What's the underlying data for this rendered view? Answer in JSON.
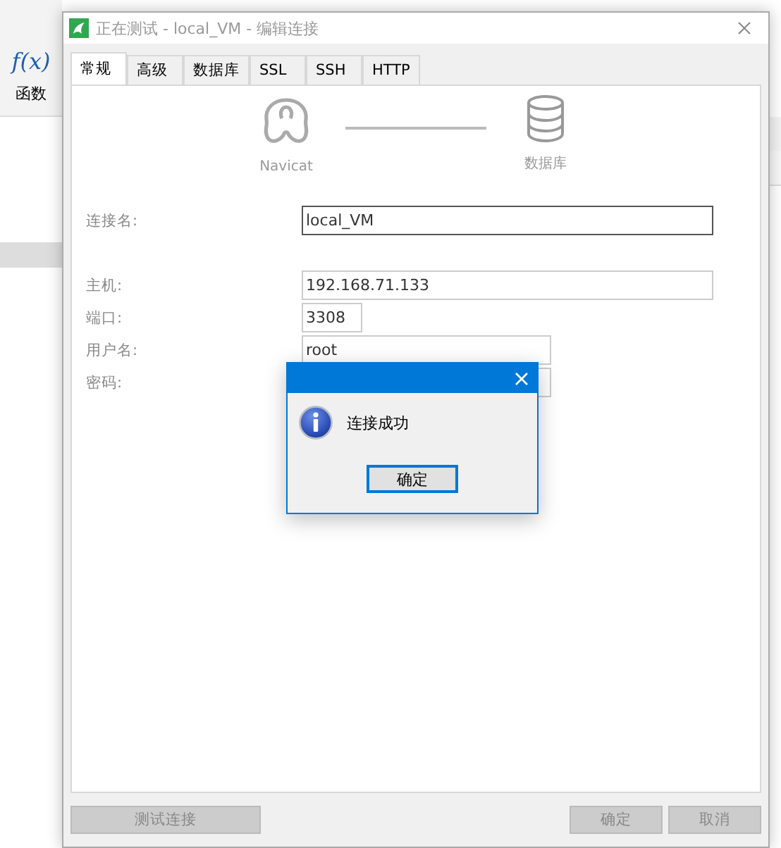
{
  "background_app": {
    "function_icon_text": "f(x)",
    "function_label": "函数"
  },
  "window": {
    "title": "正在测试 - local_VM - 编辑连接"
  },
  "tabs": [
    {
      "label": "常规",
      "selected": true
    },
    {
      "label": "高级",
      "selected": false
    },
    {
      "label": "数据库",
      "selected": false
    },
    {
      "label": "SSL",
      "selected": false
    },
    {
      "label": "SSH",
      "selected": false
    },
    {
      "label": "HTTP",
      "selected": false
    }
  ],
  "diagram": {
    "left_label": "Navicat",
    "right_label": "数据库"
  },
  "fields": [
    {
      "label": "连接名:",
      "value": "local_VM",
      "focused": true
    },
    {
      "label": "主机:",
      "value": "192.168.71.133",
      "focused": false
    },
    {
      "label": "端口:",
      "value": "3308",
      "focused": false
    },
    {
      "label": "用户名:",
      "value": "root",
      "focused": false
    },
    {
      "label": "密码:",
      "focused": false
    }
  ],
  "buttons": [
    {
      "label": "测试连接",
      "disabled": true
    },
    {
      "label": "确定",
      "disabled": true
    },
    {
      "label": "取消",
      "disabled": true
    }
  ],
  "message_box": {
    "message": "连接成功",
    "button": "确定"
  }
}
